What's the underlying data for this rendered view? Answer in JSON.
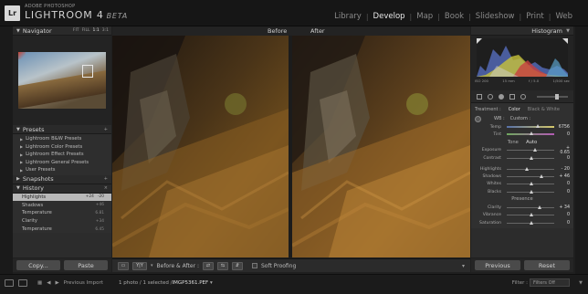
{
  "app": {
    "brand_small": "ADOBE PHOTOSHOP",
    "name": "LIGHTROOM 4",
    "beta": "BETA",
    "logo": "Lr"
  },
  "modules": [
    "Library",
    "Develop",
    "Map",
    "Book",
    "Slideshow",
    "Print",
    "Web"
  ],
  "active_module": "Develop",
  "navigator": {
    "title": "Navigator",
    "zoom": [
      "FIT",
      "FILL",
      "1:1",
      "3:1"
    ]
  },
  "presets": {
    "title": "Presets",
    "add": "+",
    "items": [
      "Lightroom B&W Presets",
      "Lightroom Color Presets",
      "Lightroom Effect Presets",
      "Lightroom General Presets",
      "User Presets"
    ]
  },
  "snapshots": {
    "title": "Snapshots",
    "add": "+"
  },
  "history": {
    "title": "History",
    "close": "×",
    "items": [
      {
        "label": "Highlights",
        "v1": "+24",
        "v2": "-20"
      },
      {
        "label": "Shadows",
        "v1": "",
        "v2": "+46"
      },
      {
        "label": "Temperature",
        "v1": "",
        "v2": "6.81"
      },
      {
        "label": "Clarity",
        "v1": "",
        "v2": "+34"
      },
      {
        "label": "Temperature",
        "v1": "",
        "v2": "6.45"
      }
    ]
  },
  "left_buttons": {
    "copy": "Copy...",
    "paste": "Paste"
  },
  "main": {
    "before": "Before",
    "after": "After"
  },
  "toolbar": {
    "before_after": "Before & After :",
    "soft_proofing": "Soft Proofing",
    "yy": "Y|Y"
  },
  "histogram": {
    "title": "Histogram",
    "info": [
      "ISO 200",
      "15 mm",
      "f / 5.0",
      "1/500 sec"
    ]
  },
  "basic": {
    "treatment_label": "Treatment :",
    "color": "Color",
    "bw": "Black & White",
    "wb_label": "WB :",
    "wb_value": "Custom :",
    "temp": {
      "label": "Temp",
      "value": "6756"
    },
    "tint": {
      "label": "Tint",
      "value": "0"
    },
    "tone": "Tone",
    "auto": "Auto",
    "exposure": {
      "label": "Exposure",
      "value": "+ 0.65"
    },
    "contrast": {
      "label": "Contrast",
      "value": "0"
    },
    "highlights": {
      "label": "Highlights",
      "value": "- 20"
    },
    "shadows": {
      "label": "Shadows",
      "value": "+ 46"
    },
    "whites": {
      "label": "Whites",
      "value": "0"
    },
    "blacks": {
      "label": "Blacks",
      "value": "0"
    },
    "presence": "Presence",
    "clarity": {
      "label": "Clarity",
      "value": "+ 34"
    },
    "vibrance": {
      "label": "Vibrance",
      "value": "0"
    },
    "saturation": {
      "label": "Saturation",
      "value": "0"
    }
  },
  "right_buttons": {
    "previous": "Previous",
    "reset": "Reset"
  },
  "filmstrip": {
    "source": "Previous Import",
    "info": "1 photo / 1 selected /",
    "file": "IMGP5361.PEF",
    "filter_label": "Filter :",
    "filter_value": "Filters Off"
  }
}
